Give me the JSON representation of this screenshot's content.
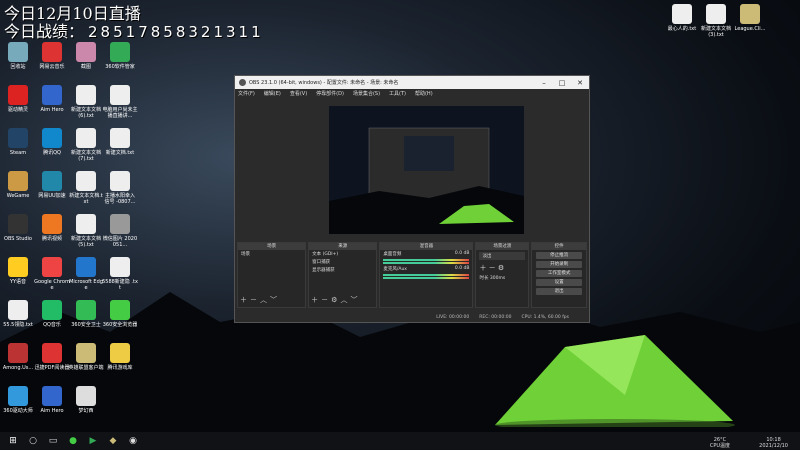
{
  "overlay": {
    "line1": "今日12月10日直播",
    "line2_prefix": "今日战绩：",
    "line2_number": "28517858321311"
  },
  "desktop_icons": [
    {
      "label": "回收站",
      "color": "#7ab"
    },
    {
      "label": "网易云音乐",
      "color": "#d33"
    },
    {
      "label": "截图",
      "color": "#c8a"
    },
    {
      "label": "360软件管家",
      "color": "#3a5"
    },
    {
      "label": "驱动精灵",
      "color": "#d22"
    },
    {
      "label": "Aim Hero",
      "color": "#36c"
    },
    {
      "label": "新建文本文档 (6).txt",
      "color": "#eee"
    },
    {
      "label": "电脑用户尚未主 播直播讲...",
      "color": "#eee"
    },
    {
      "label": "Steam",
      "color": "#246"
    },
    {
      "label": "腾讯QQ",
      "color": "#18c"
    },
    {
      "label": "新建文本文档 (7).txt",
      "color": "#eee"
    },
    {
      "label": "新建文档.txt",
      "color": "#eee"
    },
    {
      "label": "WeGame",
      "color": "#c94"
    },
    {
      "label": "网易UU加速",
      "color": "#28a"
    },
    {
      "label": "新建文本文档.txt",
      "color": "#eee"
    },
    {
      "label": "主播水阳幸入 信号 -0807...",
      "color": "#eee"
    },
    {
      "label": "OBS Studio",
      "color": "#333"
    },
    {
      "label": "腾讯视频",
      "color": "#e72"
    },
    {
      "label": "新建文本文档 (5).txt",
      "color": "#eee"
    },
    {
      "label": "微信图片 2020051...",
      "color": "#999"
    },
    {
      "label": "YY语音",
      "color": "#fc2"
    },
    {
      "label": "Google Chrome",
      "color": "#e44"
    },
    {
      "label": "Microsoft Edge",
      "color": "#27c"
    },
    {
      "label": "5588新建隐 .txt",
      "color": "#eee"
    },
    {
      "label": "55.5领隐.txt",
      "color": "#eee"
    },
    {
      "label": "QQ音乐",
      "color": "#2b6"
    },
    {
      "label": "360安全卫士",
      "color": "#3b5"
    },
    {
      "label": "360安全浏览器",
      "color": "#4c4"
    },
    {
      "label": "Among.Us...",
      "color": "#b33"
    },
    {
      "label": "迅捷PDF阅读器",
      "color": "#d33"
    },
    {
      "label": "英雄联盟客户端",
      "color": "#cb7"
    },
    {
      "label": "腾讯游戏库",
      "color": "#ec4"
    },
    {
      "label": "360驱动大师",
      "color": "#39d"
    },
    {
      "label": "Aim Hero",
      "color": "#36c"
    },
    {
      "label": "梦幻西",
      "color": "#ddd"
    }
  ],
  "right_icons": [
    {
      "label": "最心人的.txt",
      "color": "#eee"
    },
    {
      "label": "新建文本文档 (3).txt",
      "color": "#eee"
    },
    {
      "label": "League.Cli...",
      "color": "#cb7"
    }
  ],
  "obs": {
    "title": "OBS 23.1.0 (64-bit, windows) - 配置文件: 未命名 - 场景: 未命名",
    "menus": [
      "文件(F)",
      "编辑(E)",
      "查看(V)",
      "停靠部件(D)",
      "场景集合(S)",
      "工具(T)",
      "帮助(H)"
    ],
    "docks": {
      "scenes": {
        "header": "场景",
        "items": [
          "场景"
        ]
      },
      "sources": {
        "header": "来源",
        "items": [
          "文本 (GDI+)",
          "窗口捕获",
          "显示器捕获"
        ]
      },
      "mixer": {
        "header": "混音器",
        "channels": [
          {
            "name": "桌面音频",
            "db": "0.0 dB"
          },
          {
            "name": "麦克风/Aux",
            "db": "0.0 dB"
          }
        ]
      },
      "transitions": {
        "header": "场景过渡",
        "type": "淡出",
        "duration_label": "时长",
        "duration": "300ms"
      },
      "controls": {
        "header": "控件",
        "buttons": [
          "停止推流",
          "开始录制",
          "工作室模式",
          "设置",
          "退出"
        ]
      }
    },
    "status": {
      "live": "LIVE: 00:00:00",
      "rec": "REC: 00:00:00",
      "cpu": "CPU: 1.4%, 60.00 fps"
    }
  },
  "taskbar": {
    "temp": "26°C",
    "time": "10:18",
    "date": "2021/12/10",
    "cpu_label": "CPU温度"
  }
}
